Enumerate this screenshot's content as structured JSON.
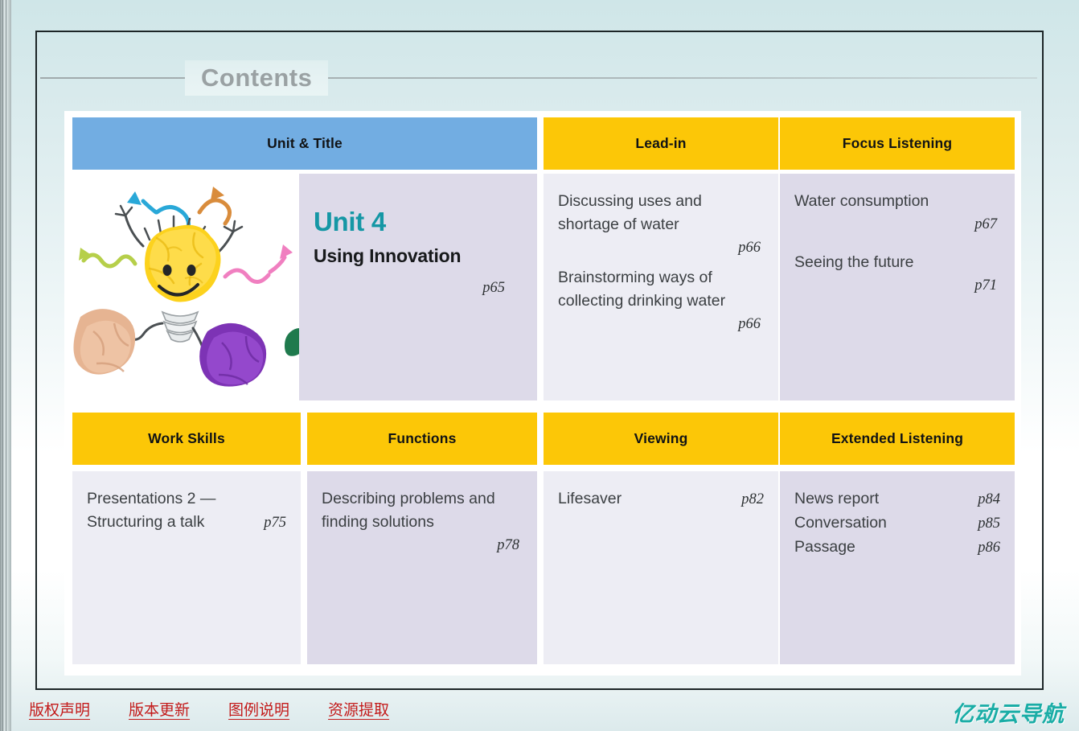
{
  "page": {
    "title": "Contents"
  },
  "colors": {
    "header_blue": "#72ade2",
    "header_gold": "#fcc707",
    "cell_tint_light": "#ededf4",
    "cell_tint_dark": "#dddae9",
    "unit_number_teal": "#1597a5",
    "footer_link_red": "#c31a1a",
    "watermark_teal": "#1aada6"
  },
  "table": {
    "row1": {
      "headers": [
        {
          "label": "Unit & Title",
          "style": "blue"
        },
        {
          "label": "Lead-in",
          "style": "gold"
        },
        {
          "label": "Focus Listening",
          "style": "gold"
        }
      ],
      "unit": {
        "number": "Unit 4",
        "name": "Using Innovation",
        "page": "p65"
      },
      "lead_in": [
        {
          "text": "Discussing uses and shortage of water",
          "page": "p66"
        },
        {
          "text": "Brainstorming ways of collecting drinking water",
          "page": "p66"
        }
      ],
      "focus_listening": [
        {
          "text": "Water consumption",
          "page": "p67"
        },
        {
          "text": "Seeing the future",
          "page": "p71"
        }
      ]
    },
    "row2": {
      "headers": [
        {
          "label": "Work Skills",
          "style": "gold"
        },
        {
          "label": "Functions",
          "style": "gold"
        },
        {
          "label": "Viewing",
          "style": "gold"
        },
        {
          "label": "Extended Listening",
          "style": "gold"
        }
      ],
      "work_skills": [
        {
          "line1": "Presentations 2 —",
          "line2": "Structuring a talk",
          "page": "p75"
        }
      ],
      "functions": [
        {
          "text": "Describing problems and finding solutions",
          "page": "p78"
        }
      ],
      "viewing": [
        {
          "text": "Lifesaver",
          "page": "p82"
        }
      ],
      "extended_listening": [
        {
          "text": "News report",
          "page": "p84"
        },
        {
          "text": "Conversation",
          "page": "p85"
        },
        {
          "text": "Passage",
          "page": "p86"
        }
      ]
    }
  },
  "illustration": {
    "name": "crumpled-paper-lightbulb-character"
  },
  "footer": {
    "links": [
      "版权声明",
      "版本更新",
      "图例说明",
      "资源提取"
    ],
    "watermark": "亿动云导航"
  }
}
